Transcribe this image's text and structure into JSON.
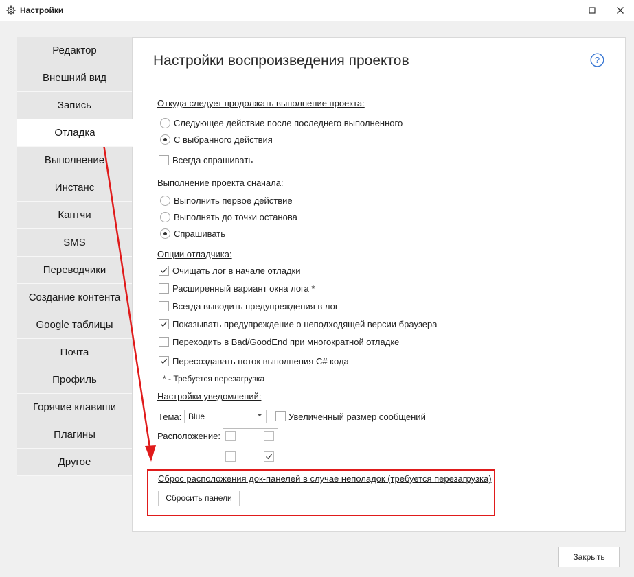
{
  "window": {
    "title": "Настройки"
  },
  "sidebar": {
    "items": [
      {
        "label": "Редактор"
      },
      {
        "label": "Внешний вид"
      },
      {
        "label": "Запись"
      },
      {
        "label": "Отладка",
        "active": true
      },
      {
        "label": "Выполнение"
      },
      {
        "label": "Инстанс"
      },
      {
        "label": "Каптчи"
      },
      {
        "label": "SMS"
      },
      {
        "label": "Переводчики"
      },
      {
        "label": "Создание контента"
      },
      {
        "label": "Google таблицы"
      },
      {
        "label": "Почта"
      },
      {
        "label": "Профиль"
      },
      {
        "label": "Горячие клавиши"
      },
      {
        "label": "Плагины"
      },
      {
        "label": "Другое"
      }
    ]
  },
  "panel": {
    "title": "Настройки воспроизведения проектов",
    "continue_section": {
      "heading": "Откуда следует продолжать выполнение проекта:",
      "options": [
        {
          "label": "Следующее действие после последнего выполненного",
          "selected": false
        },
        {
          "label": "С выбранного действия",
          "selected": true
        }
      ],
      "always_ask": {
        "label": "Всегда спрашивать",
        "checked": false
      }
    },
    "start_section": {
      "heading": "Выполнение проекта сначала:",
      "options": [
        {
          "label": "Выполнить первое действие",
          "selected": false
        },
        {
          "label": "Выполнять до точки останова",
          "selected": false
        },
        {
          "label": "Спрашивать",
          "selected": true
        }
      ]
    },
    "debugger_section": {
      "heading": "Опции отладчика:",
      "options": [
        {
          "label": "Очищать лог в начале отладки",
          "checked": true
        },
        {
          "label": "Расширенный вариант окна лога *",
          "checked": false
        },
        {
          "label": "Всегда выводить предупреждения в лог",
          "checked": false
        },
        {
          "label": "Показывать предупреждение о неподходящей версии браузера",
          "checked": true
        },
        {
          "label": "Переходить в Bad/GoodEnd при многократной отладке",
          "checked": false
        },
        {
          "label": "Пересоздавать поток выполнения C# кода",
          "checked": true
        }
      ],
      "note": "* - Требуется перезагрузка"
    },
    "notifications_section": {
      "heading": "Настройки уведомлений:",
      "theme_label": "Тема:",
      "theme_value": "Blue",
      "large_size": {
        "label": "Увеличенный размер сообщений",
        "checked": false
      },
      "position_label": "Расположение:",
      "positions": {
        "top_left": false,
        "top_right": false,
        "bottom_left": false,
        "bottom_right": true
      }
    },
    "reset_section": {
      "heading": "Сброс расположения док-панелей в случае неполадок (требуется перезагрузка)",
      "button": "Сбросить панели"
    }
  },
  "footer": {
    "close_button": "Закрыть"
  },
  "colors": {
    "annotation": "#e01b1b",
    "help": "#3a78d4"
  }
}
